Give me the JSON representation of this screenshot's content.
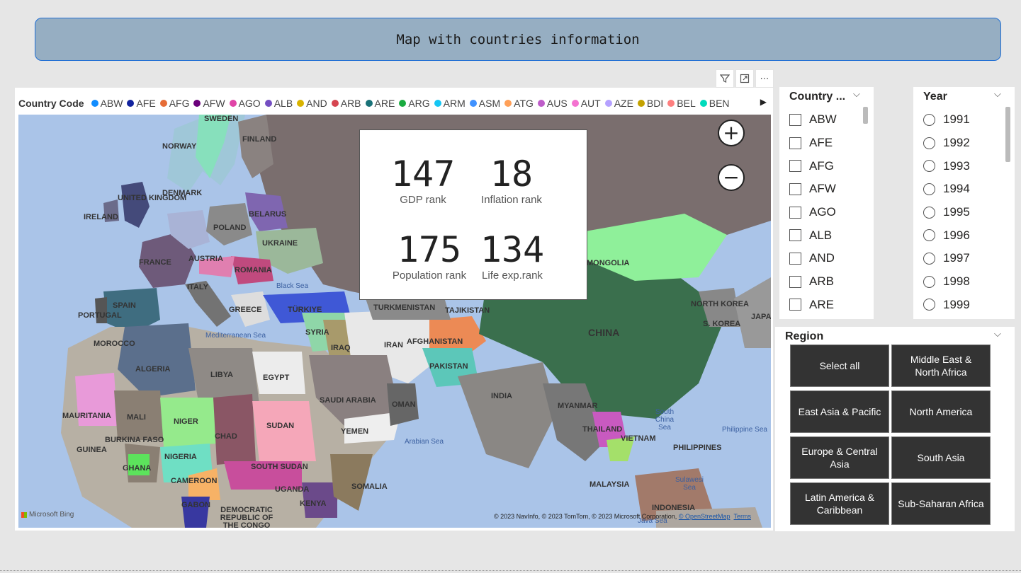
{
  "title": "Map with countries information",
  "visual_toolbar": {
    "filter_icon": "filter-icon",
    "focus_icon": "focus-mode-icon",
    "more_icon": "more-options-icon",
    "more_label": "⋯"
  },
  "legend": {
    "title": "Country Code",
    "items": [
      {
        "code": "ABW",
        "color": "#118dff"
      },
      {
        "code": "AFE",
        "color": "#12239e"
      },
      {
        "code": "AFG",
        "color": "#e66c37"
      },
      {
        "code": "AFW",
        "color": "#6b007b"
      },
      {
        "code": "AGO",
        "color": "#e044a7"
      },
      {
        "code": "ALB",
        "color": "#744ec2"
      },
      {
        "code": "AND",
        "color": "#d9b300"
      },
      {
        "code": "ARB",
        "color": "#d64550"
      },
      {
        "code": "ARE",
        "color": "#197278"
      },
      {
        "code": "ARG",
        "color": "#1aab40"
      },
      {
        "code": "ARM",
        "color": "#15c6f4"
      },
      {
        "code": "ASM",
        "color": "#4092ff"
      },
      {
        "code": "ATG",
        "color": "#ffa058"
      },
      {
        "code": "AUS",
        "color": "#be5dc9"
      },
      {
        "code": "AUT",
        "color": "#f472d0"
      },
      {
        "code": "AZE",
        "color": "#b5a1ff"
      },
      {
        "code": "BDI",
        "color": "#c4a200"
      },
      {
        "code": "BEL",
        "color": "#ff8080"
      },
      {
        "code": "BEN",
        "color": "#00dbbc"
      }
    ],
    "next_arrow": "▶"
  },
  "map": {
    "labels": [
      {
        "text": "SWEDEN"
      },
      {
        "text": "FINLAND"
      },
      {
        "text": "NORWAY"
      },
      {
        "text": "DENMARK"
      },
      {
        "text": "UNITED KINGDOM"
      },
      {
        "text": "IRELAND"
      },
      {
        "text": "BELARUS"
      },
      {
        "text": "POLAND"
      },
      {
        "text": "UKRAINE"
      },
      {
        "text": "FRANCE"
      },
      {
        "text": "AUSTRIA"
      },
      {
        "text": "ROMANIA"
      },
      {
        "text": "ITALY"
      },
      {
        "text": "SPAIN"
      },
      {
        "text": "PORTUGAL"
      },
      {
        "text": "GREECE"
      },
      {
        "text": "TÜRKIYE"
      },
      {
        "text": "TURKMENISTAN"
      },
      {
        "text": "TAJIKISTAN"
      },
      {
        "text": "MONGOLIA"
      },
      {
        "text": "NORTH KOREA"
      },
      {
        "text": "S. KOREA"
      },
      {
        "text": "JAPAN"
      },
      {
        "text": "CHINA"
      },
      {
        "text": "SYRIA"
      },
      {
        "text": "IRAQ"
      },
      {
        "text": "IRAN"
      },
      {
        "text": "AFGHANISTAN"
      },
      {
        "text": "PAKISTAN"
      },
      {
        "text": "INDIA"
      },
      {
        "text": "MYANMAR"
      },
      {
        "text": "THAILAND"
      },
      {
        "text": "VIETNAM"
      },
      {
        "text": "PHILIPPINES"
      },
      {
        "text": "MALAYSIA"
      },
      {
        "text": "INDONESIA"
      },
      {
        "text": "MOROCCO"
      },
      {
        "text": "ALGERIA"
      },
      {
        "text": "LIBYA"
      },
      {
        "text": "EGYPT"
      },
      {
        "text": "SAUDI ARABIA"
      },
      {
        "text": "OMAN"
      },
      {
        "text": "YEMEN"
      },
      {
        "text": "MAURITANIA"
      },
      {
        "text": "MALI"
      },
      {
        "text": "NIGER"
      },
      {
        "text": "CHAD"
      },
      {
        "text": "SUDAN"
      },
      {
        "text": "BURKINA FASO"
      },
      {
        "text": "GUINEA"
      },
      {
        "text": "NIGERIA"
      },
      {
        "text": "GHANA"
      },
      {
        "text": "CAMEROON"
      },
      {
        "text": "SOUTH SUDAN"
      },
      {
        "text": "GABON"
      },
      {
        "text": "UGANDA"
      },
      {
        "text": "KENYA"
      },
      {
        "text": "SOMALIA"
      },
      {
        "text": "DEMOCRATIC REPUBLIC OF THE CONGO"
      }
    ],
    "seas": [
      {
        "text": "Black Sea"
      },
      {
        "text": "Mediterranean Sea"
      },
      {
        "text": "Arabian Sea"
      },
      {
        "text": "South China Sea"
      },
      {
        "text": "Philippine Sea"
      },
      {
        "text": "Sulawesi Sea"
      },
      {
        "text": "Java Sea"
      }
    ],
    "zoom_in": "+",
    "zoom_out": "−",
    "bing": "Microsoft Bing",
    "attribution": "© 2023 NavInfo, © 2023 TomTom, © 2023 Microsoft Corporation, ",
    "osm": "© OpenStreetMap",
    "terms": "Terms"
  },
  "kpis": {
    "gdp": {
      "value": "147",
      "label": "GDP rank"
    },
    "inflation": {
      "value": "18",
      "label": "Inflation rank"
    },
    "population": {
      "value": "175",
      "label": "Population rank"
    },
    "life": {
      "value": "134",
      "label": "Life exp.rank"
    }
  },
  "country_slicer": {
    "title": "Country ...",
    "items": [
      "ABW",
      "AFE",
      "AFG",
      "AFW",
      "AGO",
      "ALB",
      "AND",
      "ARB",
      "ARE"
    ]
  },
  "year_slicer": {
    "title": "Year",
    "items": [
      "1991",
      "1992",
      "1993",
      "1994",
      "1995",
      "1996",
      "1997",
      "1998",
      "1999"
    ]
  },
  "region_slicer": {
    "title": "Region",
    "buttons": [
      "Select all",
      "Middle East & North Africa",
      "East Asia & Pacific",
      "North America",
      "Europe & Central Asia",
      "South Asia",
      "Latin America & Caribbean",
      "Sub-Saharan Africa"
    ]
  },
  "chevron": "⌵"
}
